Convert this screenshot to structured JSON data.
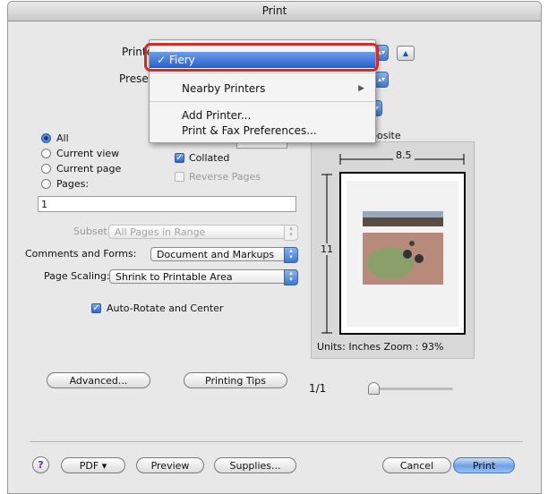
{
  "window": {
    "title": "Print"
  },
  "header": {
    "printer_label": "Printer:",
    "presets_label": "Presets:",
    "preview_mode_partial": "posite"
  },
  "printer_menu": {
    "items": [
      {
        "label": "Fiery",
        "checked": true,
        "highlighted": true
      },
      {
        "label": "Nearby Printers",
        "submenu": true
      },
      {
        "label": "Add Printer..."
      },
      {
        "label": "Print & Fax Preferences..."
      }
    ]
  },
  "pages": {
    "options": [
      {
        "label": "All",
        "selected": true
      },
      {
        "label": "Current view",
        "selected": false
      },
      {
        "label": "Current page",
        "selected": false
      },
      {
        "label": "Pages:",
        "selected": false
      }
    ],
    "range_value": "1"
  },
  "copies": {
    "collated_label": "Collated",
    "collated": true,
    "reverse_label": "Reverse Pages",
    "reverse": false
  },
  "subset": {
    "label": "Subset:",
    "value": "All Pages in Range"
  },
  "comments": {
    "label": "Comments and Forms:",
    "value": "Document and Markups"
  },
  "scaling": {
    "label": "Page Scaling:",
    "value": "Shrink to Printable Area"
  },
  "auto_rotate": {
    "label": "Auto-Rotate and Center",
    "checked": true
  },
  "preview": {
    "width_label": "8.5",
    "height_label": "11",
    "units_zoom": "Units: Inches Zoom :  93%",
    "page_indicator": "1/1"
  },
  "buttons": {
    "advanced": "Advanced...",
    "printing_tips": "Printing Tips",
    "help": "?",
    "pdf": "PDF ▾",
    "preview": "Preview",
    "supplies": "Supplies...",
    "cancel": "Cancel",
    "print": "Print"
  },
  "colors": {
    "accent": "#3c78d4",
    "highlight_box": "#d62a2a",
    "menu_highlight": "#2660cf"
  }
}
